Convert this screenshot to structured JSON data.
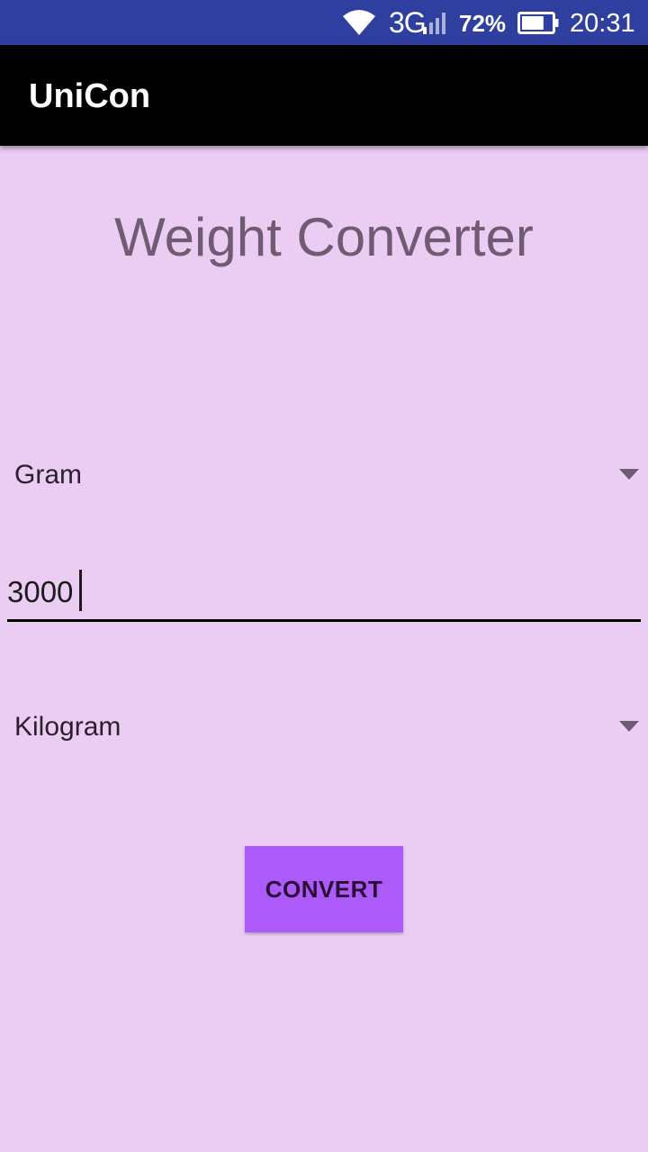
{
  "status_bar": {
    "network": "3G",
    "battery_percent": "72%",
    "battery_level": 0.72,
    "time": "20:31",
    "icons": [
      "wifi-icon",
      "signal-icon",
      "battery-icon"
    ]
  },
  "app_bar": {
    "title": "UniCon"
  },
  "main": {
    "title": "Weight Converter",
    "from_unit": "Gram",
    "amount": "3000",
    "to_unit": "Kilogram",
    "convert_label": "CONVERT"
  },
  "colors": {
    "status_bar": "#2f3f9f",
    "app_bar": "#000000",
    "background": "#ebcdf3",
    "button": "#ac5afa",
    "title_text": "#6f5b72"
  }
}
